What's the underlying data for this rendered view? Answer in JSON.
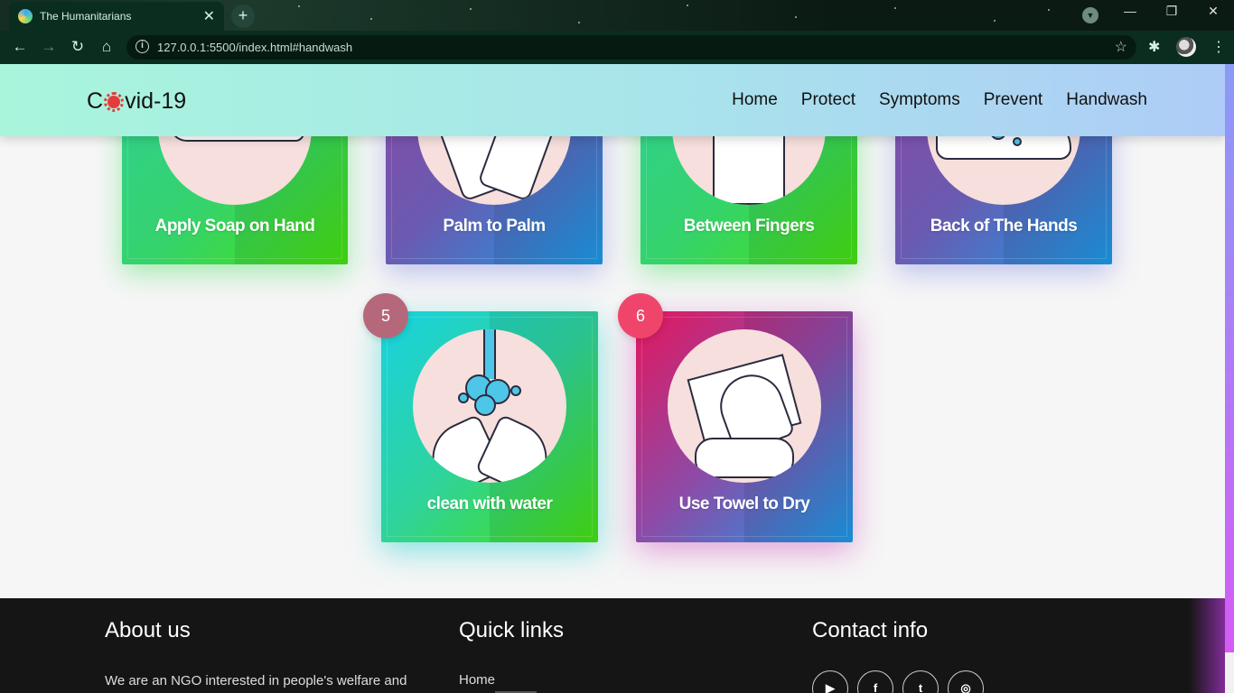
{
  "browser": {
    "tab_title": "The Humanitarians",
    "tab_close": "✕",
    "new_tab": "+",
    "url": "127.0.0.1:5500/index.html#handwash",
    "info": "i",
    "bookmark_star": "☆",
    "minimize": "—",
    "restore": "❐",
    "close": "✕",
    "back": "←",
    "forward": "→",
    "reload": "↻",
    "home": "⌂",
    "extensions": "✱",
    "menu": "⋮",
    "profile": "▼"
  },
  "site": {
    "logo_prefix": "C",
    "logo_suffix": "vid-19",
    "nav": [
      "Home",
      "Protect",
      "Symptoms",
      "Prevent",
      "Handwash"
    ]
  },
  "cards": [
    {
      "label": "Apply Soap on Hand",
      "icon": "soap-hand-icon",
      "style": "green"
    },
    {
      "label": "Palm to Palm",
      "icon": "palm-to-palm-icon",
      "style": "purple"
    },
    {
      "label": "Between Fingers",
      "icon": "between-fingers-icon",
      "style": "green"
    },
    {
      "label": "Back of The Hands",
      "icon": "back-of-hands-icon",
      "style": "purple"
    },
    {
      "number": "5",
      "label": "clean with water",
      "icon": "water-hands-icon",
      "style": "cyan"
    },
    {
      "number": "6",
      "label": "Use Towel to Dry",
      "icon": "towel-hands-icon",
      "style": "pink"
    }
  ],
  "footer": {
    "about_title": "About us",
    "about_text": "We are an NGO interested in people's welfare and",
    "quick_title": "Quick links",
    "quick_links": [
      "Home"
    ],
    "contact_title": "Contact info",
    "socials": [
      {
        "name": "youtube",
        "glyph": "▶"
      },
      {
        "name": "facebook",
        "glyph": "f"
      },
      {
        "name": "twitter",
        "glyph": "t"
      },
      {
        "name": "instagram",
        "glyph": "◎"
      }
    ]
  }
}
